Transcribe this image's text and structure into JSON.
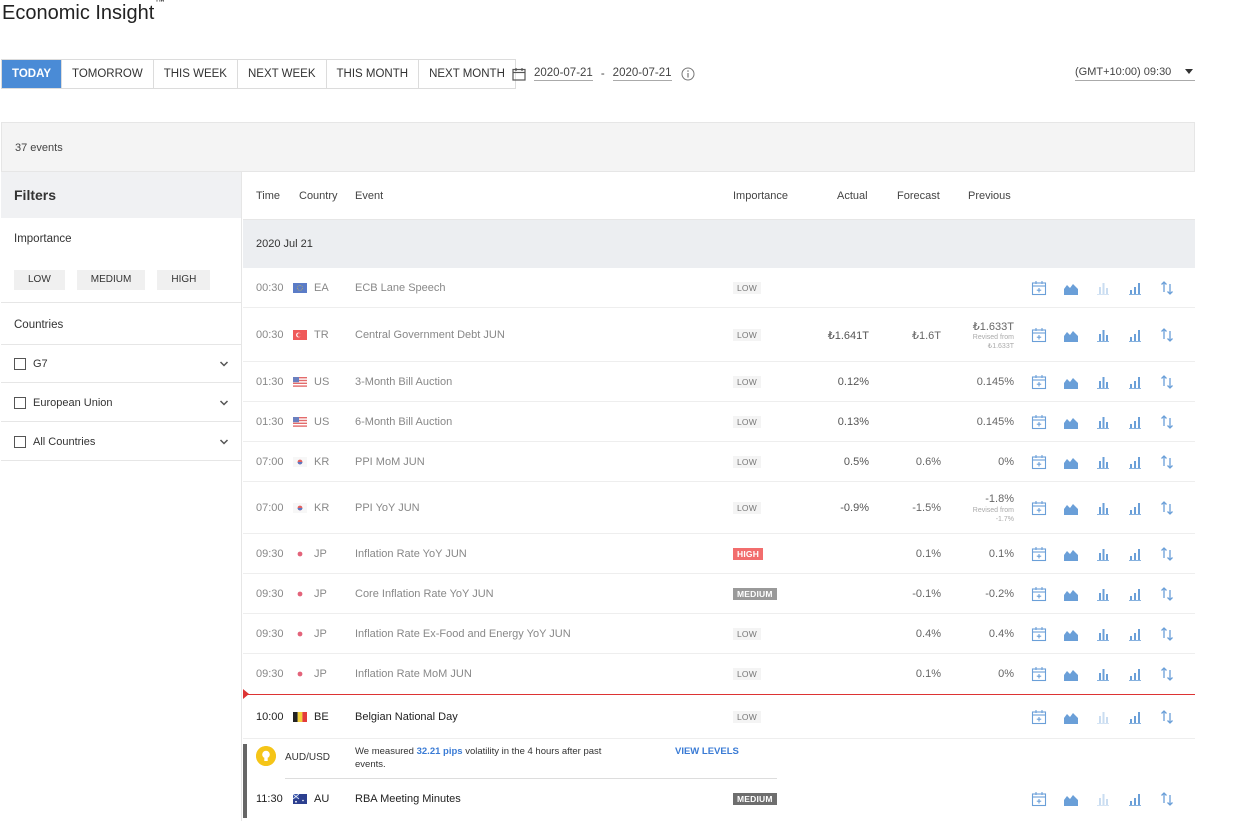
{
  "app": {
    "title": "Economic Insight",
    "trademark": "™"
  },
  "tabs": [
    {
      "label": "TODAY",
      "active": true
    },
    {
      "label": "TOMORROW"
    },
    {
      "label": "THIS WEEK"
    },
    {
      "label": "NEXT WEEK"
    },
    {
      "label": "THIS MONTH"
    },
    {
      "label": "NEXT MONTH"
    }
  ],
  "date_range": {
    "from": "2020-07-21",
    "separator": "-",
    "to": "2020-07-21"
  },
  "timezone": "(GMT+10:00) 09:30",
  "events_count": "37 events",
  "sidebar": {
    "title": "Filters",
    "importance_label": "Importance",
    "importance_buttons": [
      "LOW",
      "MEDIUM",
      "HIGH"
    ],
    "countries_label": "Countries",
    "country_groups": [
      "G7",
      "European Union",
      "All Countries"
    ]
  },
  "table": {
    "headers": {
      "time": "Time",
      "country": "Country",
      "event": "Event",
      "importance": "Importance",
      "actual": "Actual",
      "forecast": "Forecast",
      "previous": "Previous"
    },
    "date_band": "2020 Jul 21",
    "rows": [
      {
        "time": "00:30",
        "country": "EA",
        "event": "ECB Lane Speech",
        "importance": "LOW",
        "actual": "",
        "forecast": "",
        "previous": ""
      },
      {
        "time": "00:30",
        "country": "TR",
        "event": "Central Government Debt JUN",
        "importance": "LOW",
        "actual": "₺1.641T",
        "forecast": "₺1.6T",
        "previous": "₺1.633T",
        "revised": "Revised from ₺1.633T"
      },
      {
        "time": "01:30",
        "country": "US",
        "event": "3-Month Bill Auction",
        "importance": "LOW",
        "actual": "0.12%",
        "forecast": "",
        "previous": "0.145%"
      },
      {
        "time": "01:30",
        "country": "US",
        "event": "6-Month Bill Auction",
        "importance": "LOW",
        "actual": "0.13%",
        "forecast": "",
        "previous": "0.145%"
      },
      {
        "time": "07:00",
        "country": "KR",
        "event": "PPI MoM JUN",
        "importance": "LOW",
        "actual": "0.5%",
        "forecast": "0.6%",
        "previous": "0%"
      },
      {
        "time": "07:00",
        "country": "KR",
        "event": "PPI YoY JUN",
        "importance": "LOW",
        "actual": "-0.9%",
        "forecast": "-1.5%",
        "previous": "-1.8%",
        "revised": "Revised from -1.7%"
      },
      {
        "time": "09:30",
        "country": "JP",
        "event": "Inflation Rate YoY JUN",
        "importance": "HIGH",
        "actual": "",
        "forecast": "0.1%",
        "previous": "0.1%"
      },
      {
        "time": "09:30",
        "country": "JP",
        "event": "Core Inflation Rate YoY JUN",
        "importance": "MEDIUM",
        "actual": "",
        "forecast": "-0.1%",
        "previous": "-0.2%"
      },
      {
        "time": "09:30",
        "country": "JP",
        "event": "Inflation Rate Ex-Food and Energy YoY JUN",
        "importance": "LOW",
        "actual": "",
        "forecast": "0.4%",
        "previous": "0.4%"
      },
      {
        "time": "09:30",
        "country": "JP",
        "event": "Inflation Rate MoM JUN",
        "importance": "LOW",
        "actual": "",
        "forecast": "0.1%",
        "previous": "0%"
      },
      {
        "time": "10:00",
        "country": "BE",
        "event": "Belgian National Day",
        "importance": "LOW",
        "actual": "",
        "forecast": "",
        "previous": ""
      },
      {
        "time": "11:30",
        "country": "AU",
        "event": "RBA Meeting Minutes",
        "importance": "MEDIUM",
        "actual": "",
        "forecast": "",
        "previous": ""
      }
    ]
  },
  "volatility": {
    "pair": "AUD/USD",
    "text_before": "We measured ",
    "pips": "32.21 pips",
    "text_after": " volatility in the 4 hours after past events.",
    "link": "VIEW LEVELS"
  },
  "colors": {
    "accent": "#4a8bd6",
    "high": "#f26d6d",
    "medium": "#9a9a9a",
    "now_line": "#dd3333",
    "icon": "#6a9fd8"
  },
  "icons": [
    "calendar-icon",
    "info-icon",
    "chevron-down-icon",
    "add-to-calendar-icon",
    "area-chart-icon",
    "bar-chart-icon",
    "column-chart-icon",
    "sort-arrows-icon",
    "lightbulb-icon"
  ]
}
